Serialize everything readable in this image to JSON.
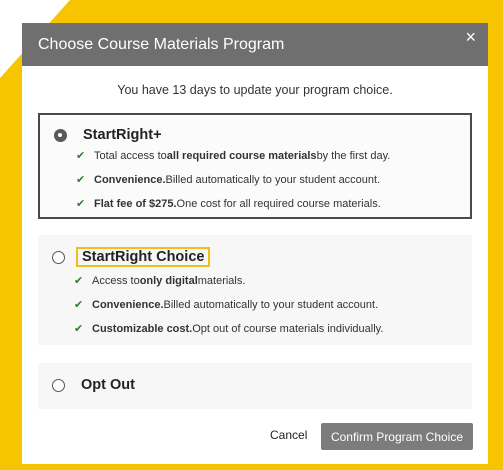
{
  "modal": {
    "title": "Choose Course Materials Program",
    "close": "×",
    "notice": "You have 13 days to update your program choice."
  },
  "options": [
    {
      "title": "StartRight+",
      "selected": true,
      "bullets": [
        {
          "pre": "Total access to ",
          "bold": "all required course materials",
          "post": " by the first day."
        },
        {
          "pre": "",
          "bold": "Convenience.",
          "post": " Billed automatically to your student account."
        },
        {
          "pre": "",
          "bold": "Flat fee of $275.",
          "post": " One cost for all required course materials."
        }
      ]
    },
    {
      "title": "StartRight Choice",
      "selected": false,
      "bullets": [
        {
          "pre": "Access to ",
          "bold": "only digital",
          "post": " materials."
        },
        {
          "pre": "",
          "bold": "Convenience.",
          "post": " Billed automatically to your student account."
        },
        {
          "pre": "",
          "bold": "Customizable cost.",
          "post": " Opt out of course materials individually."
        }
      ]
    },
    {
      "title": "Opt Out",
      "selected": false,
      "bullets": []
    }
  ],
  "footer": {
    "cancel": "Cancel",
    "confirm": "Confirm Program Choice"
  },
  "icons": {
    "check": "check-icon",
    "close": "close-icon"
  },
  "colors": {
    "accent_yellow": "#f7c500",
    "header_gray": "#6f6f6f",
    "check_green": "#2e7d32",
    "button_gray": "#7c7c7c"
  }
}
